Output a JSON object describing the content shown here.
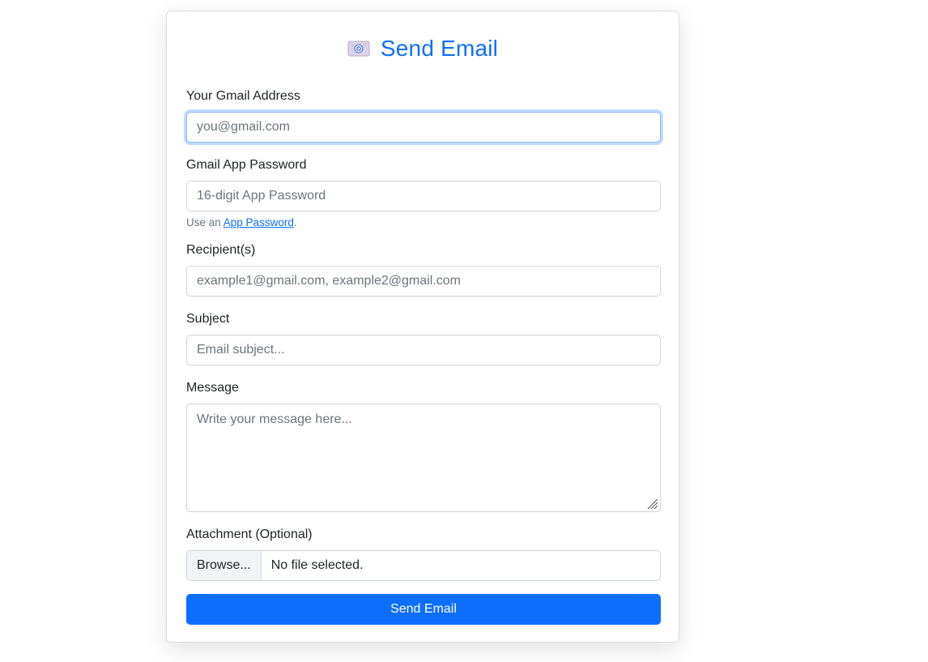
{
  "header": {
    "title": "Send Email",
    "icon": "envelope-icon"
  },
  "form": {
    "gmail": {
      "label": "Your Gmail Address",
      "placeholder": "you@gmail.com",
      "value": ""
    },
    "password": {
      "label": "Gmail App Password",
      "placeholder": "16-digit App Password",
      "value": "",
      "help_prefix": "Use an ",
      "help_link": "App Password",
      "help_suffix": "."
    },
    "recipients": {
      "label": "Recipient(s)",
      "placeholder": "example1@gmail.com, example2@gmail.com",
      "value": ""
    },
    "subject": {
      "label": "Subject",
      "placeholder": "Email subject...",
      "value": ""
    },
    "message": {
      "label": "Message",
      "placeholder": "Write your message here...",
      "value": ""
    },
    "attachment": {
      "label": "Attachment (Optional)",
      "browse_label": "Browse...",
      "file_status": "No file selected."
    },
    "submit_label": "Send Email"
  },
  "colors": {
    "accent": "#0d6efd",
    "border": "#ced4da",
    "muted": "#6c757d"
  }
}
